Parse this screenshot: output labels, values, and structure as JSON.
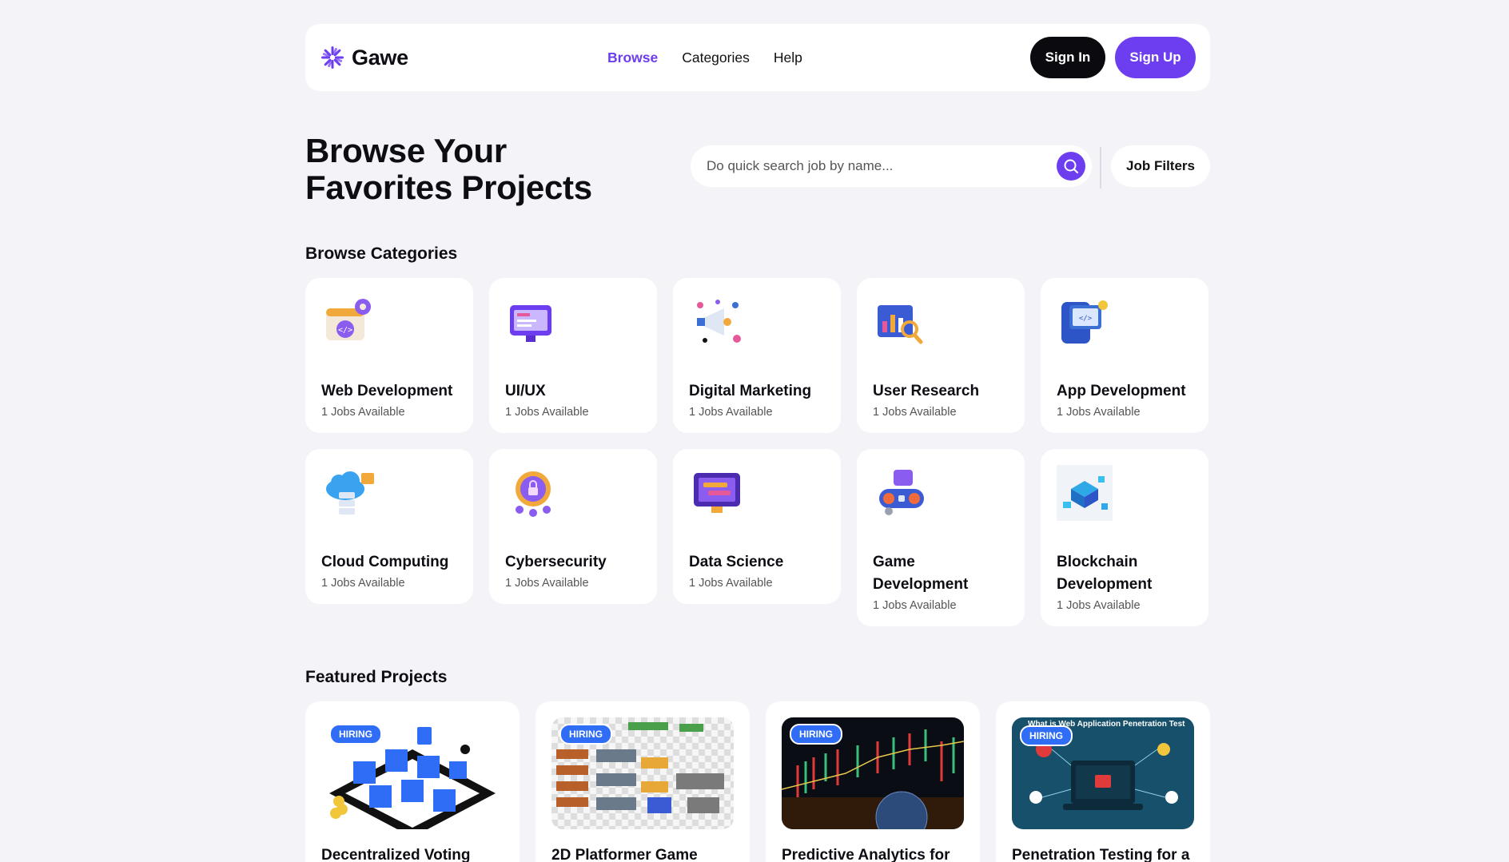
{
  "brand": {
    "name": "Gawe",
    "accent": "#6d3ef0",
    "dark": "#0b0b0f",
    "hiring_blue": "#2f6df6"
  },
  "nav": {
    "items": [
      {
        "label": "Browse",
        "active": true
      },
      {
        "label": "Categories",
        "active": false
      },
      {
        "label": "Help",
        "active": false
      }
    ]
  },
  "auth": {
    "sign_in": "Sign In",
    "sign_up": "Sign Up"
  },
  "hero": {
    "title_line1": "Browse Your",
    "title_line2": "Favorites Projects"
  },
  "search": {
    "placeholder": "Do quick search job by name...",
    "icon": "search-icon",
    "filters_label": "Job Filters"
  },
  "categories": {
    "title": "Browse Categories",
    "items": [
      {
        "name": "Web Development",
        "jobs": "1 Jobs Available",
        "icon": "web-development-icon"
      },
      {
        "name": "UI/UX",
        "jobs": "1 Jobs Available",
        "icon": "ui-ux-icon"
      },
      {
        "name": "Digital Marketing",
        "jobs": "1 Jobs Available",
        "icon": "digital-marketing-icon"
      },
      {
        "name": "User Research",
        "jobs": "1 Jobs Available",
        "icon": "user-research-icon"
      },
      {
        "name": "App Development",
        "jobs": "1 Jobs Available",
        "icon": "app-development-icon"
      },
      {
        "name": "Cloud Computing",
        "jobs": "1 Jobs Available",
        "icon": "cloud-computing-icon"
      },
      {
        "name": "Cybersecurity",
        "jobs": "1 Jobs Available",
        "icon": "cybersecurity-icon"
      },
      {
        "name": "Data Science",
        "jobs": "1 Jobs Available",
        "icon": "data-science-icon"
      },
      {
        "name": "Game Development",
        "jobs": "1 Jobs Available",
        "icon": "game-development-icon"
      },
      {
        "name": "Blockchain Development",
        "jobs": "1 Jobs Available",
        "icon": "blockchain-development-icon"
      }
    ]
  },
  "featured": {
    "title": "Featured Projects",
    "badge": "HIRING",
    "items": [
      {
        "title": "Decentralized Voting"
      },
      {
        "title": "2D Platformer Game"
      },
      {
        "title": "Predictive Analytics for"
      },
      {
        "title": "Penetration Testing for a",
        "thumb_caption": "What is Web Application Penetration Test"
      }
    ]
  }
}
